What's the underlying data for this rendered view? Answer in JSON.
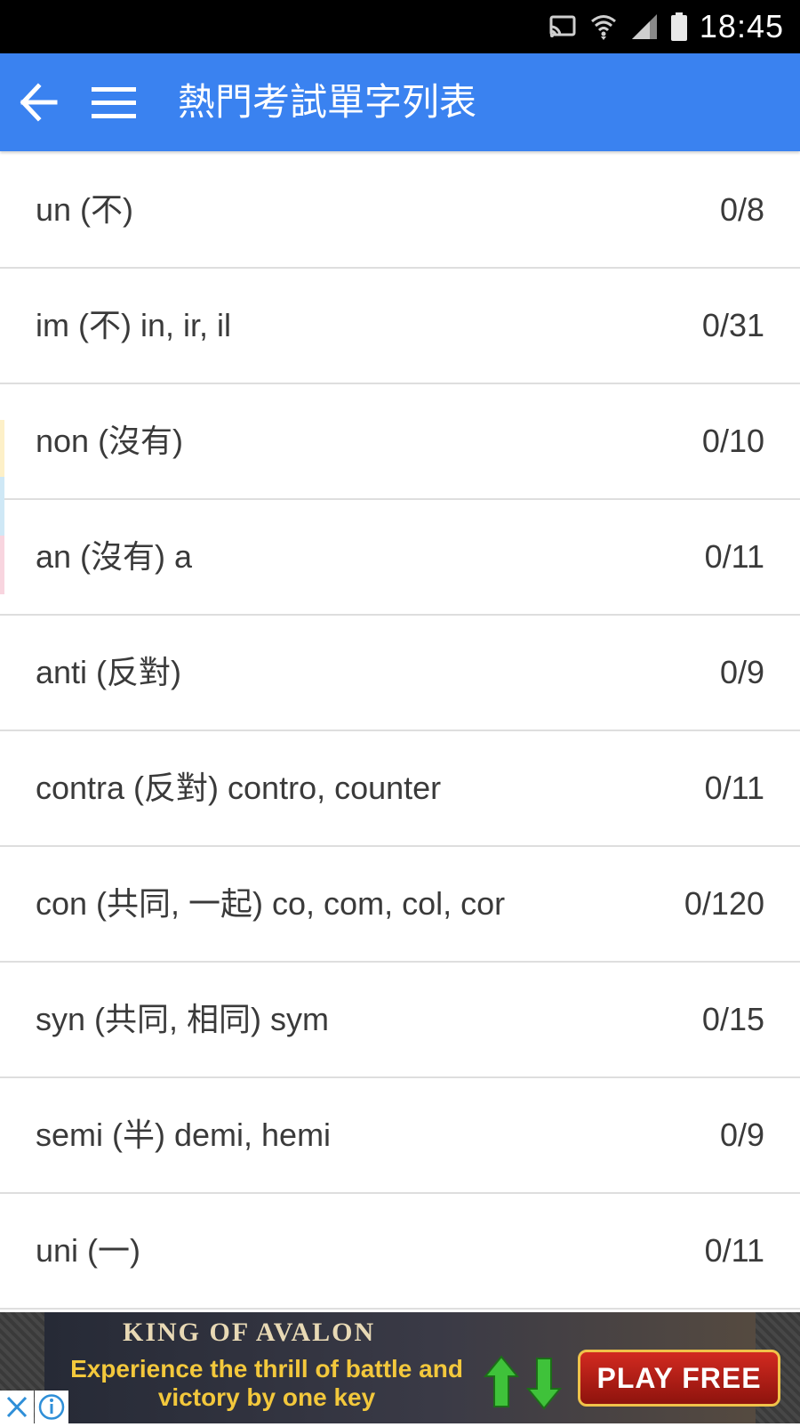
{
  "status_bar": {
    "time": "18:45",
    "icons": [
      "cast-icon",
      "wifi-icon",
      "signal-icon",
      "battery-icon"
    ]
  },
  "app_bar": {
    "title": "熱門考試單字列表",
    "back_icon": "arrow-left-icon",
    "menu_icon": "hamburger-menu-icon",
    "background_color": "#3a82f0"
  },
  "list": {
    "items": [
      {
        "title": "un (不)",
        "count": "0/8"
      },
      {
        "title": "im (不) in, ir, il",
        "count": "0/31"
      },
      {
        "title": "non (沒有)",
        "count": "0/10"
      },
      {
        "title": "an (沒有) a",
        "count": "0/11"
      },
      {
        "title": "anti (反對)",
        "count": "0/9"
      },
      {
        "title": "contra (反對) contro, counter",
        "count": "0/11"
      },
      {
        "title": "con (共同, 一起) co, com, col, cor",
        "count": "0/120"
      },
      {
        "title": "syn (共同, 相同) sym",
        "count": "0/15"
      },
      {
        "title": "semi (半) demi, hemi",
        "count": "0/9"
      },
      {
        "title": "uni (一)",
        "count": "0/11"
      }
    ],
    "accent_stripe_colors": [
      "#fdf0c8",
      "#cfe8f6",
      "#f8d5df"
    ]
  },
  "ad": {
    "brand": "KING OF AVALON",
    "tagline": "Experience the thrill of battle and victory by one key",
    "cta": "PLAY FREE",
    "close_icon": "close-x-icon",
    "info_icon": "info-icon"
  }
}
